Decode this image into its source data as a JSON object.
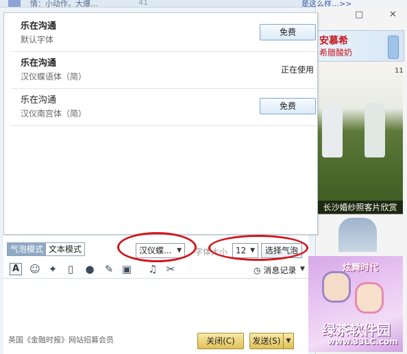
{
  "background": {
    "top_text": "情：小动作，大爆…",
    "top_like": "41",
    "top_right": "是这么样…>>",
    "left_link": "…"
  },
  "right_panel": {
    "close": "✕",
    "restore": "□",
    "ad_top_title": "安慕希",
    "ad_top_sub": "希腊酸奶",
    "photo_number": "11",
    "photo_caption": "长沙婚纱照客片欣赏",
    "ad_dance_title": "炫舞时代",
    "ad_dance_logo": "绿茶软件园",
    "ad_dance_url": "www.33LC.com"
  },
  "font_list": [
    {
      "sample": "乐在沟通",
      "name": "默认字体",
      "button": "免费",
      "status": ""
    },
    {
      "sample": "乐在沟通",
      "name": "汉仪蝶语体（简）",
      "button": "",
      "status": "正在使用"
    },
    {
      "sample": "乐在沟通",
      "name": "汉仪南宫体（简）",
      "button": "免费",
      "status": ""
    }
  ],
  "toolbar": {
    "mode_bubble": "气泡模式",
    "mode_text": "文本模式",
    "font_select": "汉仪蝶...",
    "size_label": "字体大小",
    "size_select": "12",
    "bubble_button": "选择气泡",
    "history": "消息记录"
  },
  "icons": {
    "font": "A",
    "emoji": "☺",
    "magic": "✦",
    "video": "▯",
    "mic": "●",
    "edit": "✎",
    "image": "▣",
    "music": "♫",
    "scissors": "✂",
    "clock": "◷"
  },
  "footer": {
    "promo": "英国《金融时报》网站招募会员",
    "close": "关闭(C)",
    "send": "发送(S)"
  },
  "colors": {
    "highlight_ring": "#d0151c",
    "button_gold": "#e2c157",
    "button_blue": "#dceaf6"
  }
}
